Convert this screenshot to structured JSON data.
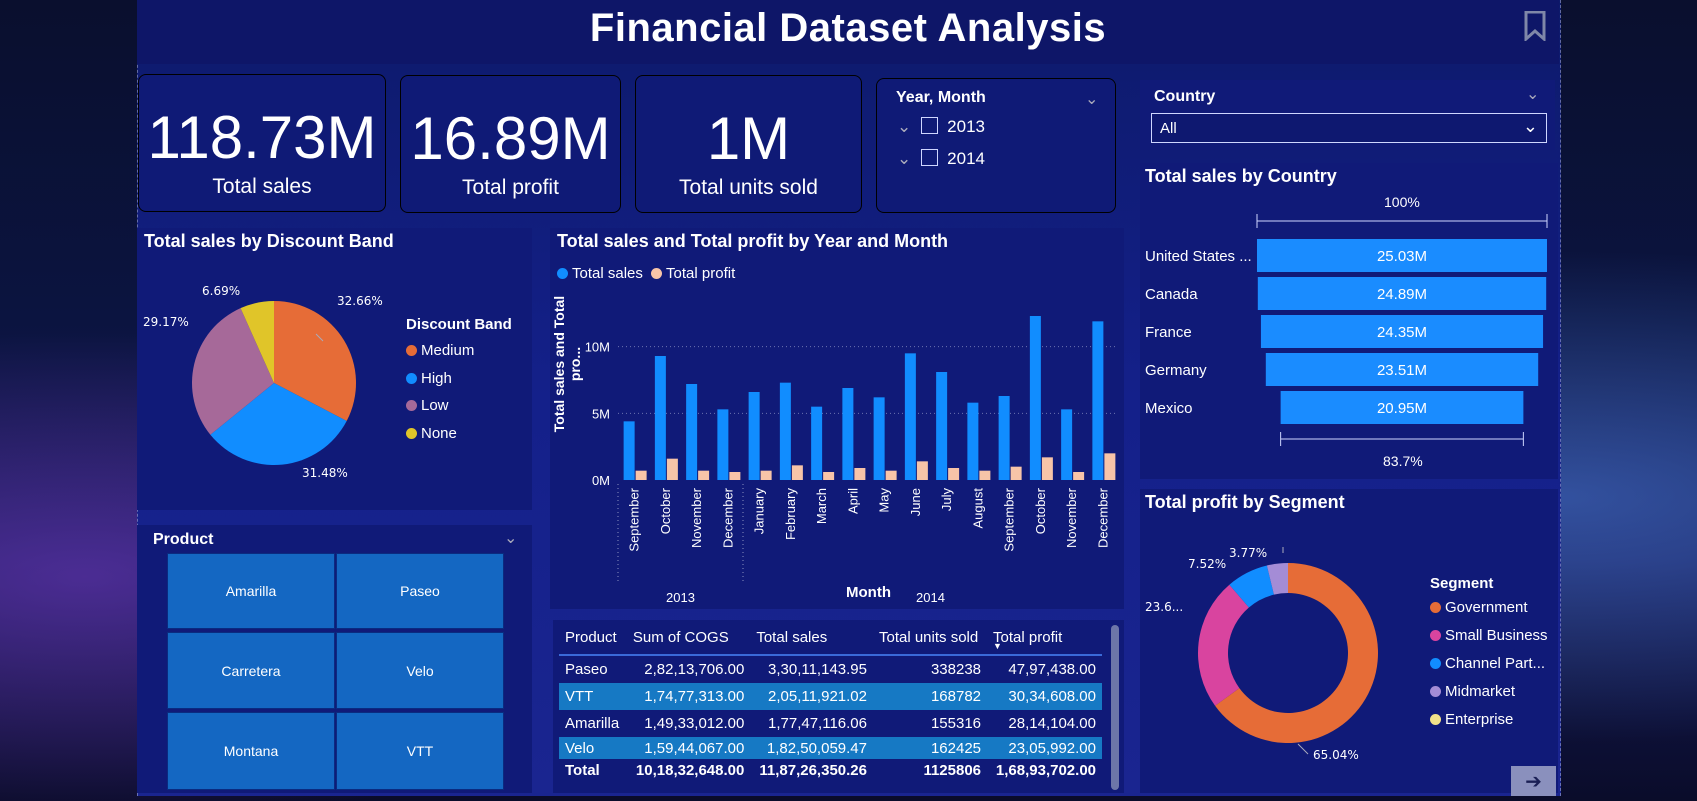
{
  "title": "Financial Dataset Analysis",
  "kpis": [
    {
      "value": "118.73M",
      "label": "Total sales"
    },
    {
      "value": "16.89M",
      "label": "Total profit"
    },
    {
      "value": "1M",
      "label": "Total units sold"
    }
  ],
  "year_slicer": {
    "title": "Year, Month",
    "items": [
      "2013",
      "2014"
    ]
  },
  "country_slicer": {
    "title": "Country",
    "selected": "All"
  },
  "discount_pie": {
    "title": "Total sales by Discount Band",
    "legend_title": "Discount Band",
    "slices": [
      {
        "name": "Medium",
        "pct": 32.66,
        "label": "32.66%",
        "color": "#e66c37"
      },
      {
        "name": "High",
        "pct": 31.48,
        "label": "31.48%",
        "color": "#118dff"
      },
      {
        "name": "Low",
        "pct": 29.17,
        "label": "29.17%",
        "color": "#a66999"
      },
      {
        "name": "None",
        "pct": 6.69,
        "label": "6.69%",
        "color": "#e0c529"
      }
    ]
  },
  "chart_data": {
    "type": "bar",
    "title": "Total sales and Total profit by Year and Month",
    "xlabel": "Month",
    "ylabel": "Total sales and Total pro...",
    "ylim": [
      0,
      12000000
    ],
    "yticks": [
      "0M",
      "5M",
      "10M"
    ],
    "categories": [
      "September",
      "October",
      "November",
      "December",
      "January",
      "February",
      "March",
      "April",
      "May",
      "June",
      "July",
      "August",
      "September",
      "October",
      "November",
      "December"
    ],
    "years": [
      {
        "label": "2013",
        "count": 4
      },
      {
        "label": "2014",
        "count": 12
      }
    ],
    "series": [
      {
        "name": "Total sales",
        "color": "#118dff",
        "values": [
          4.4,
          9.3,
          7.2,
          5.3,
          6.6,
          7.3,
          5.5,
          6.9,
          6.2,
          9.5,
          8.1,
          5.8,
          6.3,
          12.3,
          5.3,
          11.9
        ]
      },
      {
        "name": "Total profit",
        "color": "#f7c4a8",
        "values": [
          0.7,
          1.6,
          0.7,
          0.6,
          0.7,
          1.1,
          0.6,
          0.9,
          0.7,
          1.4,
          0.9,
          0.7,
          1.0,
          1.7,
          0.6,
          2.0
        ]
      }
    ]
  },
  "country_bars": {
    "title": "Total sales by Country",
    "top_label": "100%",
    "bottom_label": "83.7%",
    "items": [
      {
        "name": "United States ...",
        "label": "25.03M",
        "value": 25.03
      },
      {
        "name": "Canada",
        "label": "24.89M",
        "value": 24.89
      },
      {
        "name": "France",
        "label": "24.35M",
        "value": 24.35
      },
      {
        "name": "Germany",
        "label": "23.51M",
        "value": 23.51
      },
      {
        "name": "Mexico",
        "label": "20.95M",
        "value": 20.95
      }
    ]
  },
  "product_slicer": {
    "title": "Product",
    "tiles": [
      "Amarilla",
      "Paseo",
      "Carretera",
      "Velo",
      "Montana",
      "VTT"
    ]
  },
  "table": {
    "headers": [
      "Product",
      "Sum of COGS",
      "Total sales",
      "Total units sold",
      "Total profit"
    ],
    "rows": [
      [
        "Paseo",
        "2,82,13,706.00",
        "3,30,11,143.95",
        "338238",
        "47,97,438.00"
      ],
      [
        "VTT",
        "1,74,77,313.00",
        "2,05,11,921.02",
        "168782",
        "30,34,608.00"
      ],
      [
        "Amarilla",
        "1,49,33,012.00",
        "1,77,47,116.06",
        "155316",
        "28,14,104.00"
      ],
      [
        "Velo",
        "1,59,44,067.00",
        "1,82,50,059.47",
        "162425",
        "23,05,992.00"
      ]
    ],
    "total": [
      "Total",
      "10,18,32,648.00",
      "11,87,26,350.26",
      "1125806",
      "1,68,93,702.00"
    ]
  },
  "segment_donut": {
    "title": "Total profit by Segment",
    "legend_title": "Segment",
    "slices": [
      {
        "name": "Government",
        "pct": 65.04,
        "label": "65.04%",
        "color": "#e66c37"
      },
      {
        "name": "Small Business",
        "pct": 23.67,
        "label": "23.6...",
        "color": "#d9449f"
      },
      {
        "name": "Channel Part...",
        "pct": 7.52,
        "label": "7.52%",
        "color": "#118dff"
      },
      {
        "name": "Midmarket",
        "pct": 3.77,
        "label": "3.77%",
        "color": "#a48cd6"
      },
      {
        "name": "Enterprise",
        "pct": 0.0,
        "label": "",
        "color": "#f2e28a"
      }
    ]
  }
}
